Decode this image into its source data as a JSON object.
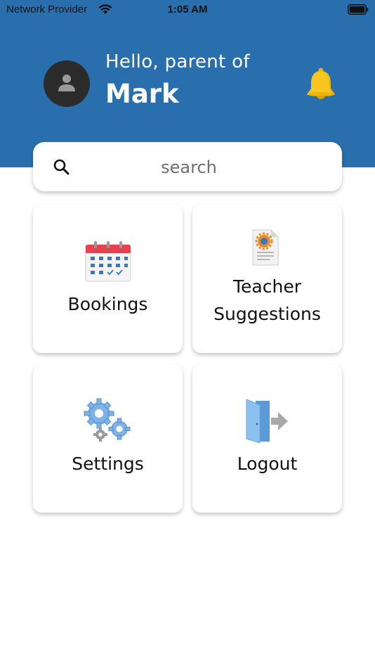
{
  "status_bar": {
    "carrier": "Network Provider",
    "time": "1:05 AM"
  },
  "header": {
    "greeting": "Hello, parent of",
    "child_name": "Mark",
    "background_color": "#2a6fad",
    "avatar_icon": "person-icon",
    "notification_icon": "bell-icon"
  },
  "search": {
    "placeholder": "search",
    "icon": "search-icon"
  },
  "tiles": [
    {
      "label_line1": "Bookings",
      "label_line2": "",
      "icon": "calendar-icon"
    },
    {
      "label_line1": "Teacher",
      "label_line2": "Suggestions",
      "icon": "document-icon"
    },
    {
      "label_line1": "Settings",
      "label_line2": "",
      "icon": "gears-icon"
    },
    {
      "label_line1": "Logout",
      "label_line2": "",
      "icon": "exit-door-icon"
    }
  ]
}
